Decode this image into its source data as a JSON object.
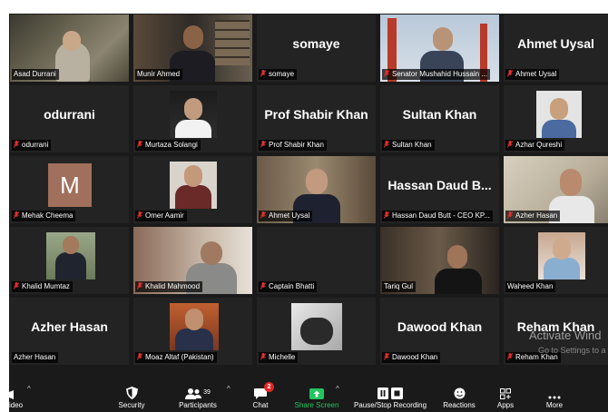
{
  "participants": [
    {
      "name": "Asad Durrani",
      "big": "",
      "muted": false,
      "active": true
    },
    {
      "name": "Munir Ahmed",
      "big": "",
      "muted": false
    },
    {
      "name": "somaye",
      "big": "somaye",
      "muted": true
    },
    {
      "name": "Senator Mushahid Hussain ...",
      "big": "",
      "muted": true
    },
    {
      "name": "Ahmet Uysal",
      "big": "Ahmet Uysal",
      "muted": true
    },
    {
      "name": "odurrani",
      "big": "odurrani",
      "muted": true
    },
    {
      "name": "Murtaza Solangi",
      "big": "",
      "muted": true
    },
    {
      "name": "Prof Shabir Khan",
      "big": "Prof Shabir Khan",
      "muted": true
    },
    {
      "name": "Sultan Khan",
      "big": "Sultan Khan",
      "muted": true
    },
    {
      "name": "Azhar Qureshi",
      "big": "",
      "muted": true
    },
    {
      "name": "Mehak Cheema",
      "big": "",
      "muted": true,
      "letter": "M"
    },
    {
      "name": "Omer Aamir",
      "big": "",
      "muted": true
    },
    {
      "name": "Ahmet Uysal",
      "big": "",
      "muted": true
    },
    {
      "name": "Hassan Daud Butt - CEO KP...",
      "big": "Hassan Daud B...",
      "muted": true
    },
    {
      "name": "Azher Hasan",
      "big": "",
      "muted": true
    },
    {
      "name": "Khalid Mumtaz",
      "big": "",
      "muted": true
    },
    {
      "name": "Khalid Mahmood",
      "big": "",
      "muted": true
    },
    {
      "name": "Captain Bhatti",
      "big": "",
      "muted": true
    },
    {
      "name": "Tariq Gul",
      "big": "",
      "muted": false
    },
    {
      "name": "Waheed Khan",
      "big": "",
      "muted": false
    },
    {
      "name": "Azher Hasan",
      "big": "Azher Hasan",
      "muted": false
    },
    {
      "name": "Moaz Altaf (Pakistan)",
      "big": "",
      "muted": true
    },
    {
      "name": "Michelle",
      "big": "",
      "muted": true
    },
    {
      "name": "Dawood Khan",
      "big": "Dawood Khan",
      "muted": true
    },
    {
      "name": "Reham Khan",
      "big": "Reham Khan",
      "muted": true
    }
  ],
  "toolbar": {
    "video_label": "ideo",
    "security_label": "Security",
    "participants_label": "Participants",
    "participants_count": "39",
    "chat_label": "Chat",
    "chat_badge": "2",
    "share_label": "Share Screen",
    "recording_label": "Pause/Stop Recording",
    "reactions_label": "Reactions",
    "apps_label": "Apps",
    "more_label": "More"
  },
  "overlay": {
    "activate_title": "Activate Wind",
    "activate_sub": "Go to Settings to a"
  },
  "colors": {
    "active_speaker": "#e3e34a",
    "mute_red": "#e03030",
    "share_green": "#22c55e",
    "chat_badge": "#e02828"
  }
}
